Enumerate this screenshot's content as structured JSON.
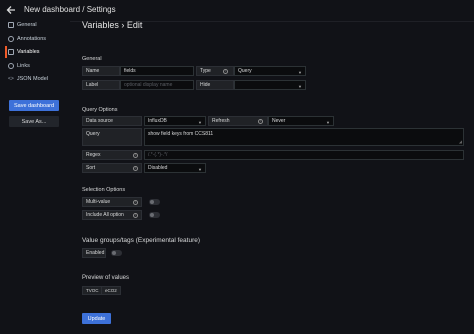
{
  "header": {
    "title": "New dashboard / Settings",
    "back_icon": "arrow-left-icon"
  },
  "sidebar": {
    "items": [
      {
        "label": "General",
        "icon": "sliders-icon"
      },
      {
        "label": "Annotations",
        "icon": "comment-icon"
      },
      {
        "label": "Variables",
        "icon": "grid-icon",
        "active": true
      },
      {
        "label": "Links",
        "icon": "link-icon"
      },
      {
        "label": "JSON Model",
        "icon": "code-icon"
      }
    ],
    "save_label": "Save dashboard",
    "save_as_label": "Save As..."
  },
  "page": {
    "title": "Variables › Edit"
  },
  "general": {
    "heading": "General",
    "name_label": "Name",
    "name_value": "fields",
    "type_label": "Type",
    "type_value": "Query",
    "label_label": "Label",
    "label_placeholder": "optional display name",
    "hide_label": "Hide",
    "hide_value": ""
  },
  "query_options": {
    "heading": "Query Options",
    "datasource_label": "Data source",
    "datasource_value": "InfluxDB",
    "refresh_label": "Refresh",
    "refresh_value": "Never",
    "query_label": "Query",
    "query_value": "show field keys from CCS811",
    "regex_label": "Regex",
    "regex_placeholder": "/.*-(.*)-.*/",
    "sort_label": "Sort",
    "sort_value": "Disabled"
  },
  "selection_options": {
    "heading": "Selection Options",
    "multi_label": "Multi-value",
    "include_all_label": "Include All option"
  },
  "value_groups": {
    "heading": "Value groups/tags (Experimental feature)",
    "enabled_label": "Enabled"
  },
  "preview": {
    "heading": "Preview of values",
    "values": [
      "TVOC",
      "eCO2"
    ]
  },
  "update_label": "Update",
  "colors": {
    "primary": "#3d71d9",
    "active_accent": "#f05a28",
    "background": "#111217"
  }
}
